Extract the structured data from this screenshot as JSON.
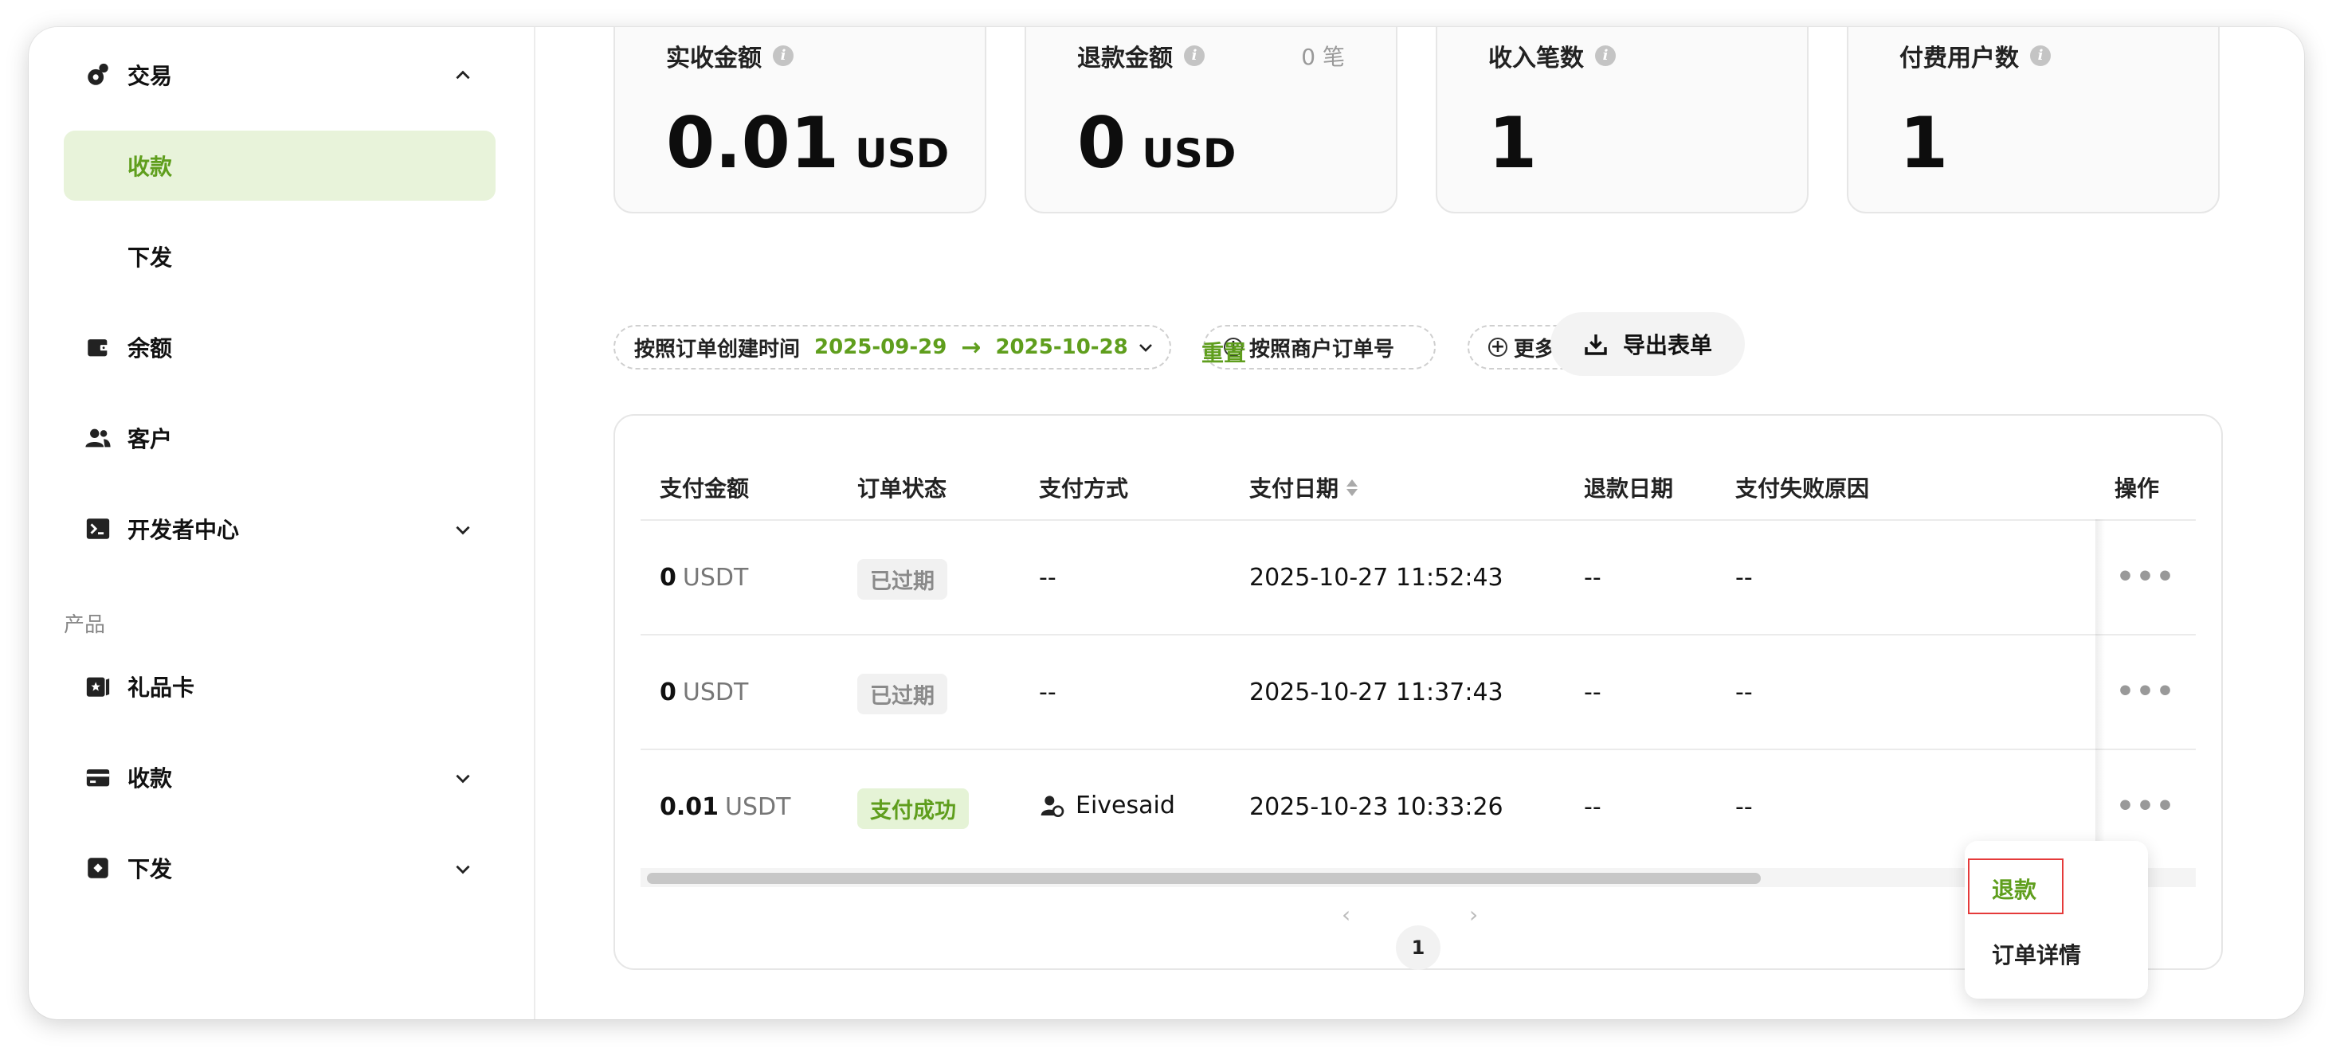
{
  "sidebar": {
    "nav_trade": "交易",
    "sub_collect": "收款",
    "sub_payout": "下发",
    "nav_balance": "余额",
    "nav_customers": "客户",
    "nav_developer": "开发者中心",
    "section_products": "产品",
    "nav_giftcard": "礼品卡",
    "nav_collection": "收款",
    "nav_payout": "下发"
  },
  "cards": [
    {
      "label": "实收金额",
      "value": "0.01",
      "unit": "USD",
      "extra": ""
    },
    {
      "label": "退款金额",
      "value": "0",
      "unit": "USD",
      "extra": "0 笔"
    },
    {
      "label": "收入笔数",
      "value": "1",
      "unit": "",
      "extra": ""
    },
    {
      "label": "付费用户数",
      "value": "1",
      "unit": "",
      "extra": ""
    }
  ],
  "filters": {
    "created_label": "按照订单创建时间",
    "date_start": "2025-09-29",
    "arrow": "→",
    "date_end": "2025-10-28",
    "merchant_order": "按照商户订单号",
    "more": "更多筛选",
    "reset": "重置",
    "export": "导出表单"
  },
  "table": {
    "columns": [
      "支付金额",
      "订单状态",
      "支付方式",
      "支付日期",
      "退款日期",
      "支付失败原因",
      "操作"
    ],
    "rows": [
      {
        "amount": "0",
        "currency": "USDT",
        "status": "已过期",
        "method": "--",
        "paid_at": "2025-10-27 11:52:43",
        "refund_at": "--",
        "fail_reason": "--",
        "action": "•••"
      },
      {
        "amount": "0",
        "currency": "USDT",
        "status": "已过期",
        "method": "--",
        "paid_at": "2025-10-27 11:37:43",
        "refund_at": "--",
        "fail_reason": "--",
        "action": "•••"
      },
      {
        "amount": "0.01",
        "currency": "USDT",
        "status": "支付成功",
        "method": "Eivesaid",
        "paid_at": "2025-10-23 10:33:26",
        "refund_at": "--",
        "fail_reason": "--",
        "action": "•••"
      }
    ]
  },
  "pagination": {
    "prev": "‹",
    "page": "1",
    "next": "›"
  },
  "menu": {
    "refund": "退款",
    "detail": "订单详情"
  },
  "colors": {
    "accent": "#5f9e1d",
    "active_bg": "#e8f3da",
    "highlight": "#e53a3a"
  }
}
